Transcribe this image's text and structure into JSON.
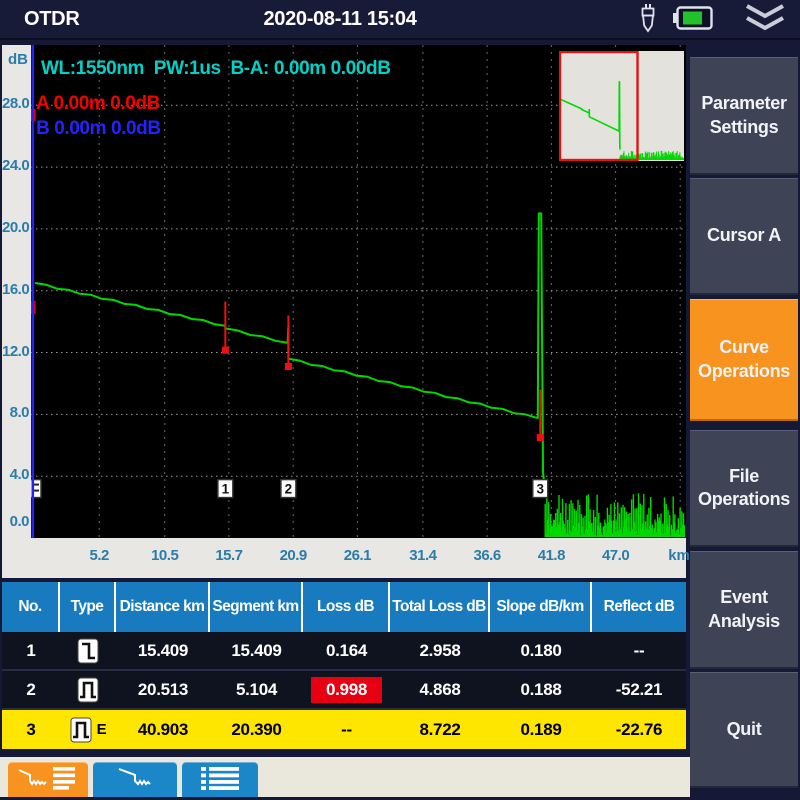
{
  "header": {
    "app_title": "OTDR",
    "datetime": "2020-08-11 15:04",
    "battery_color": "#21c32a"
  },
  "chart": {
    "info_line": "WL:1550nm  PW:1us  B-A: 0.00m 0.00dB",
    "cursor_a_line": "A 0.00m 0.0dB",
    "cursor_b_line": "B 0.00m 0.0dB",
    "y_axis_title": "dB",
    "x_axis_unit": "km",
    "colors": {
      "trace": "#00d900",
      "info_text": "#00d2c8",
      "cursor_a": "#f50000",
      "cursor_b": "#2323ff",
      "event_marker": "#ee1111",
      "axis_text": "#2b7cad",
      "plot_bg": "#000000",
      "minimap_bg": "#e3e2dd"
    }
  },
  "chart_data": {
    "type": "line",
    "title": "OTDR trace",
    "xlabel": "km",
    "ylabel": "dB",
    "x_ticks": [
      5.2,
      10.5,
      15.7,
      20.9,
      26.1,
      31.4,
      36.6,
      41.8,
      47.0
    ],
    "y_ticks": [
      0.0,
      4.0,
      8.0,
      12.0,
      16.0,
      20.0,
      24.0,
      28.0
    ],
    "xlim": [
      0,
      52.7
    ],
    "ylim": [
      0,
      31.9
    ],
    "trace_points": [
      [
        0,
        16.5
      ],
      [
        15.409,
        13.73
      ],
      [
        15.409,
        13.56
      ],
      [
        20.45,
        12.63
      ],
      [
        20.513,
        13.72
      ],
      [
        20.513,
        11.6
      ],
      [
        40.6,
        7.78
      ],
      [
        40.7,
        7.78
      ],
      [
        40.78,
        21.0
      ],
      [
        40.98,
        21.0
      ],
      [
        41.12,
        4.3
      ],
      [
        41.3,
        2.8
      ]
    ],
    "noise": {
      "x_start": 41.3,
      "x_end": 52.6,
      "amp_min": 0.9,
      "amp_max": 2.9,
      "floor_max": 1.1,
      "seed": 12
    },
    "events": [
      {
        "label": "1",
        "x": 15.409,
        "line_top": 15.3,
        "line_bottom": 12.15
      },
      {
        "label": "2",
        "x": 20.513,
        "line_top": 14.4,
        "line_bottom": 11.1
      },
      {
        "label": "3",
        "x": 40.903,
        "line_top": 9.6,
        "line_bottom": 6.5
      }
    ],
    "marker_label_db": 3.78,
    "minimap": {
      "xlim": [
        0,
        84.6
      ],
      "view_fraction": 0.62
    }
  },
  "sidebar": {
    "active_color": "#f7931e",
    "buttons": [
      {
        "label": "Parameter Settings",
        "active": false
      },
      {
        "label": "Cursor A",
        "active": false
      },
      {
        "label": "Curve Operations",
        "active": true
      },
      {
        "label": "File Operations",
        "active": false
      },
      {
        "label": "Event Analysis",
        "active": false
      },
      {
        "label": "Quit",
        "active": false
      }
    ]
  },
  "event_table": {
    "headers": [
      "No.",
      "Type",
      "Distance km",
      "Segment km",
      "Loss dB",
      "Total Loss dB",
      "Slope dB/km",
      "Reflect dB"
    ],
    "rows": [
      {
        "no": "1",
        "type_icon": "step-down",
        "type_suffix": "",
        "distance": "15.409",
        "segment": "15.409",
        "loss": "0.164",
        "loss_highlighted": false,
        "total_loss": "2.958",
        "slope": "0.180",
        "reflect": "--",
        "highlight": "none"
      },
      {
        "no": "2",
        "type_icon": "pulse",
        "type_suffix": "",
        "distance": "20.513",
        "segment": "5.104",
        "loss": "0.998",
        "loss_highlighted": true,
        "total_loss": "4.868",
        "slope": "0.188",
        "reflect": "-52.21",
        "highlight": "none"
      },
      {
        "no": "3",
        "type_icon": "pulse",
        "type_suffix": "E",
        "distance": "40.903",
        "segment": "20.390",
        "loss": "--",
        "loss_highlighted": false,
        "total_loss": "8.722",
        "slope": "0.189",
        "reflect": "-22.76",
        "highlight": "yellow"
      }
    ]
  },
  "toolbar": {
    "tabs": [
      {
        "icon": "trace-and-list",
        "active": true
      },
      {
        "icon": "trace",
        "active": false
      },
      {
        "icon": "list",
        "active": false
      }
    ]
  }
}
